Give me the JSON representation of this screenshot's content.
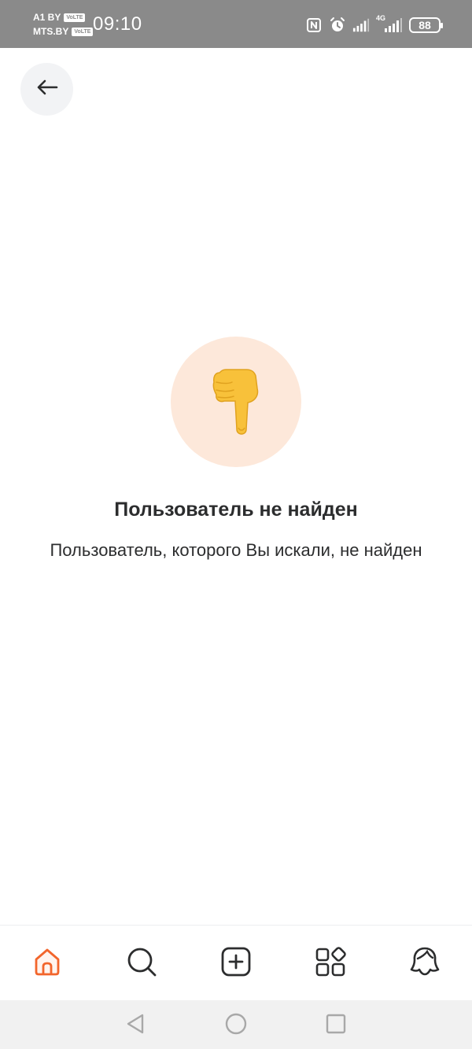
{
  "status_bar": {
    "carrier_1": "A1 BY",
    "carrier_2": "MTS.BY",
    "volte_badge": "VoLTE",
    "time": "09:10",
    "network_type": "4G",
    "battery_level": "88",
    "icons": [
      "nfc-icon",
      "alarm-icon",
      "signal-icon",
      "signal-icon",
      "battery-icon"
    ]
  },
  "header": {
    "back_icon": "arrow-left-icon"
  },
  "empty_state": {
    "emoji": "👇",
    "emoji_background": "#fde8da",
    "title": "Пользователь не найден",
    "message": "Пользователь, которого Вы искали, не найден"
  },
  "tabbar": {
    "active_color": "#f2652b",
    "inactive_color": "#2c2d2e",
    "tabs": [
      {
        "icon": "home-icon",
        "active": true
      },
      {
        "icon": "search-icon",
        "active": false
      },
      {
        "icon": "add-post-icon",
        "active": false
      },
      {
        "icon": "services-grid-icon",
        "active": false
      },
      {
        "icon": "profile-icon",
        "active": false
      }
    ]
  },
  "system_nav": {
    "buttons": [
      "back-triangle-icon",
      "home-circle-icon",
      "recents-square-icon"
    ]
  }
}
